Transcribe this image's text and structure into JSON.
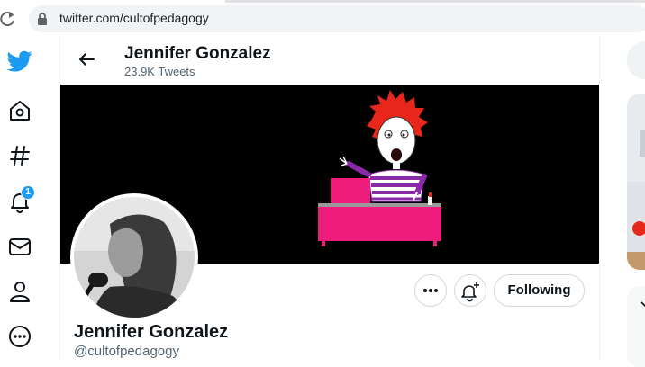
{
  "browser": {
    "url": "twitter.com/cultofpedagogy",
    "icons": [
      "reload-icon",
      "lock-icon"
    ]
  },
  "nav": {
    "items": [
      {
        "name": "twitter-logo-icon"
      },
      {
        "name": "home-icon"
      },
      {
        "name": "explore-hashtag-icon"
      },
      {
        "name": "notifications-bell-icon",
        "badge": "1"
      },
      {
        "name": "messages-envelope-icon"
      },
      {
        "name": "profile-person-icon"
      },
      {
        "name": "more-circle-icon"
      }
    ]
  },
  "header": {
    "name": "Jennifer Gonzalez",
    "tweet_count": "23.9K Tweets"
  },
  "profile": {
    "name": "Jennifer Gonzalez",
    "handle": "@cultofpedagogy",
    "following_label": "Following"
  },
  "colors": {
    "twitter_blue": "#1d9bf0",
    "banner_bg": "#000000",
    "desk_pink": "#ee1c7d",
    "hair_red": "#e8271c",
    "shirt_purple": "#8b2aa8"
  }
}
